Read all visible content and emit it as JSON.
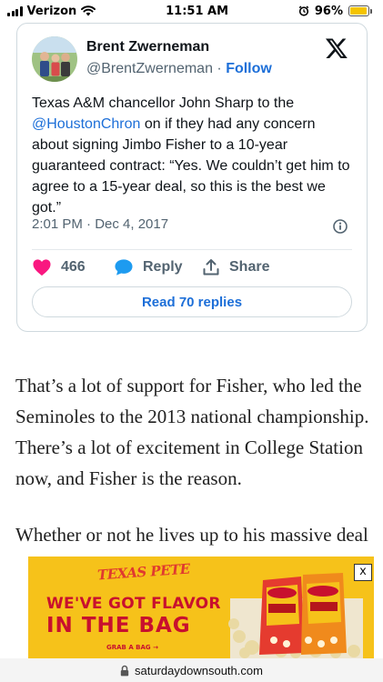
{
  "status_bar": {
    "carrier": "Verizon",
    "time": "11:51 AM",
    "battery_percent": "96%",
    "battery_level": 0.96,
    "icons": [
      "signal-icon",
      "wifi-icon",
      "alarm-icon",
      "battery-icon"
    ]
  },
  "tweet": {
    "author_name": "Brent Zwerneman",
    "handle": "@BrentZwerneman",
    "separator": " · ",
    "follow_label": "Follow",
    "text_before": "Texas A&M chancellor John Sharp to the ",
    "mention": "@HoustonChron",
    "text_after": " on if they had any concern about signing Jimbo Fisher to a 10-year guaranteed contract: “Yes. We couldn’t get him to agree to a 15-year deal, so this is the best we got.”",
    "timestamp": "2:01 PM · Dec 4, 2017",
    "likes": "466",
    "reply_label": "Reply",
    "share_label": "Share",
    "read_replies_label": "Read 70 replies",
    "colors": {
      "link": "#1d6fd8",
      "like": "#f91880",
      "muted": "#536471"
    }
  },
  "article": {
    "paragraph1": "That’s a lot of support for Fisher, who led the Seminoles to the 2013 national championship. There’s a lot of excitement in College Station now, and Fisher is the reason.",
    "paragraph2": "Whether or not he lives up to his massive deal"
  },
  "ad": {
    "brand": "TEXAS PETE",
    "headline_line1": "WE'VE GOT FLAVOR",
    "headline_line2": "IN THE BAG",
    "cta": "GRAB A BAG →",
    "close_label": "x",
    "colors": {
      "background": "#f6c21a",
      "red": "#c8102e"
    }
  },
  "url_bar": {
    "domain": "saturdaydownsouth.com"
  }
}
